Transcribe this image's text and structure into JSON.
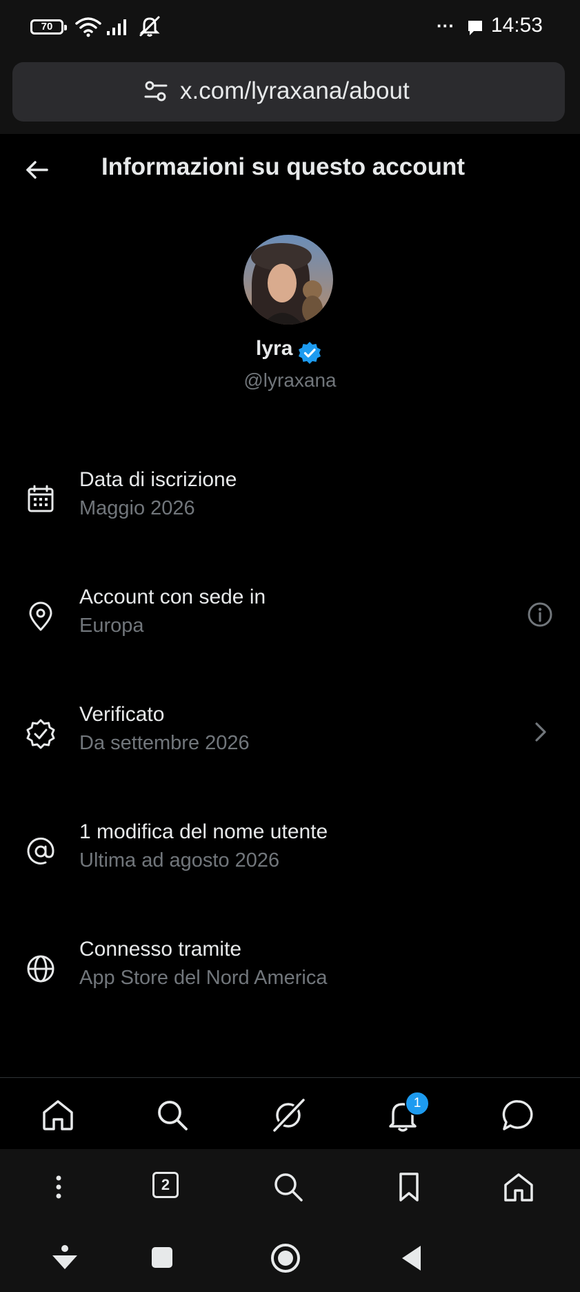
{
  "status_bar": {
    "battery": "70",
    "overflow": "···",
    "time": "14:53"
  },
  "browser": {
    "url": "x.com/lyraxana/about",
    "tab_count": "2"
  },
  "header": {
    "title": "Informazioni su questo account"
  },
  "profile": {
    "name": "lyra",
    "handle": "@lyraxana"
  },
  "info": [
    {
      "icon": "calendar-icon",
      "title": "Data di iscrizione",
      "subtitle": "Maggio 2026"
    },
    {
      "icon": "location-pin-icon",
      "title": "Account con sede in",
      "subtitle": "Europa",
      "trailing": "info-icon"
    },
    {
      "icon": "verified-badge-icon",
      "title": "Verificato",
      "subtitle": "Da settembre 2026",
      "trailing": "chevron-right-icon"
    },
    {
      "icon": "at-sign-icon",
      "title": "1 modifica del nome utente",
      "subtitle": "Ultima ad agosto 2026"
    },
    {
      "icon": "globe-icon",
      "title": "Connesso tramite",
      "subtitle": "App Store del Nord America"
    }
  ],
  "app_nav": {
    "items": [
      "home-icon",
      "search-icon",
      "grok-icon",
      "notifications-icon",
      "messages-icon"
    ],
    "notification_badge": "1"
  },
  "browser_toolbar": {
    "items": [
      "menu-icon",
      "tabs-icon",
      "search-icon",
      "bookmark-icon",
      "home-icon"
    ]
  },
  "colors": {
    "background": "#000000",
    "text_primary": "#e7e9ea",
    "text_secondary": "#71767b",
    "accent_blue": "#1d9bf0",
    "chrome": "#121212"
  }
}
